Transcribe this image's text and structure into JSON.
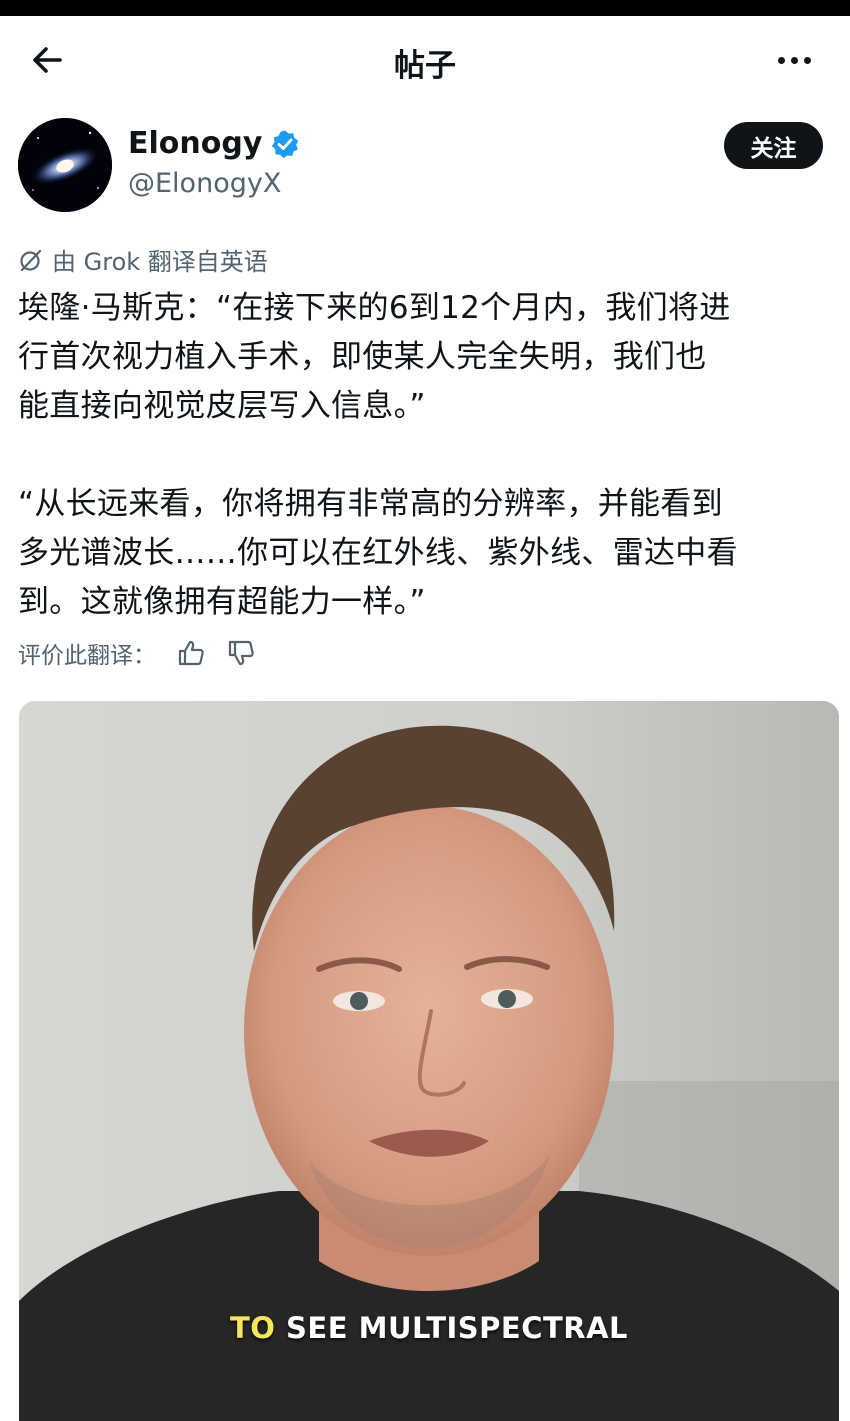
{
  "nav": {
    "title": "帖子"
  },
  "author": {
    "name": "Elonogy",
    "handle": "@ElonogyX",
    "follow_label": "关注"
  },
  "translation_note": "由 Grok 翻译自英语",
  "post": {
    "paragraphs": [
      [
        "埃隆·马斯克：“在接下来的6到12个月内，我们将进",
        "行首次视力植入手术，即使某人完全失明，我们也",
        "能直接向视觉皮层写入信息。”"
      ],
      [
        "“从长远来看，你将拥有非常高的分辨率，并能看到",
        "多光谱波长……你可以在红外线、紫外线、雷达中看",
        "到。这就像拥有超能力一样。”"
      ]
    ]
  },
  "rate_label": "评价此翻译：",
  "video": {
    "caption_highlight": "TO",
    "caption_rest": " SEE MULTISPECTRAL"
  },
  "colors": {
    "verified": "#1d9bf0",
    "text": "#0f1419",
    "muted": "#536471",
    "caption_highlight": "#f5e65a"
  }
}
